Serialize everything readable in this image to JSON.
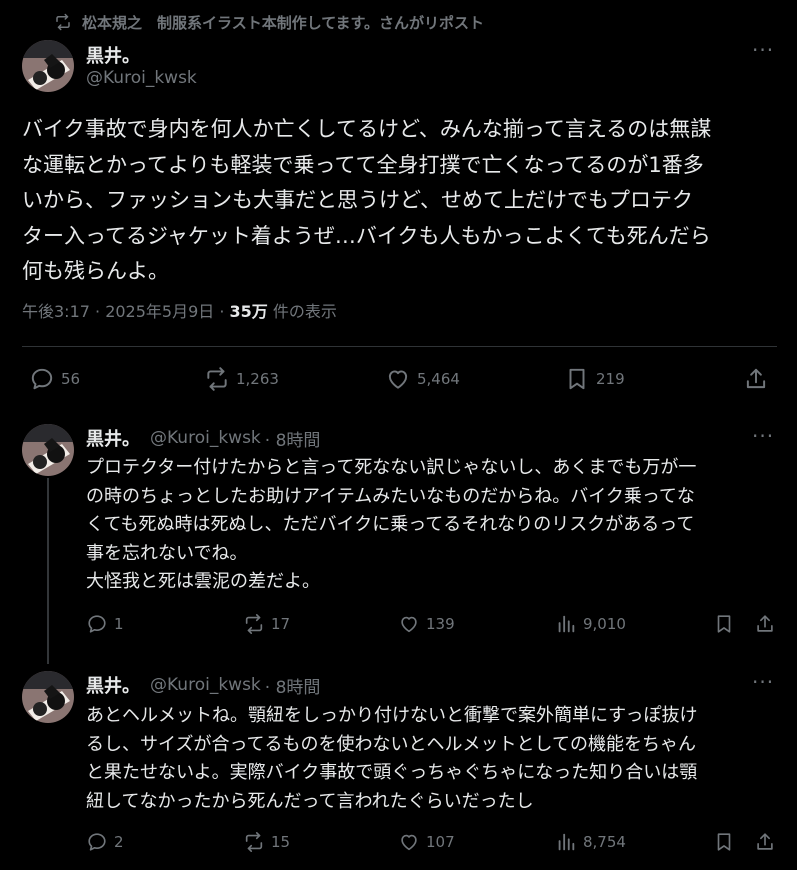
{
  "repost": {
    "text": "松本規之　制服系イラスト本制作してます。さんがリポスト"
  },
  "main": {
    "name": "黒井。",
    "handle": "@Kuroi_kwsk",
    "lines": [
      "バイク事故で身内を何人か亡くしてるけど、みんな揃って言えるのは無謀",
      "な運転とかってよりも軽装で乗ってて全身打撲で亡くなってるのが1番多",
      "いから、ファッションも大事だと思うけど、せめて上だけでもプロテク",
      "ター入ってるジャケット着ようぜ…バイクも人もかっこよくても死んだら",
      "何も残らんよ。"
    ],
    "time": "午後3:17 · 2025年5月9日 · ",
    "views_count": "35万",
    "views_label": " 件の表示",
    "stats": {
      "replies": "56",
      "reposts": "1,263",
      "likes": "5,464",
      "bookmarks": "219"
    }
  },
  "replies": [
    {
      "name": "黒井。",
      "handle": "@Kuroi_kwsk",
      "time": "· 8時間",
      "lines": [
        "プロテクター付けたからと言って死なない訳じゃないし、あくまでも万が一",
        "の時のちょっとしたお助けアイテムみたいなものだからね。バイク乗ってな",
        "くても死ぬ時は死ぬし、ただバイクに乗ってるそれなりのリスクがあるって",
        "事を忘れないでね。",
        "大怪我と死は雲泥の差だよ。"
      ],
      "stats": {
        "replies": "1",
        "reposts": "17",
        "likes": "139",
        "views": "9,010"
      }
    },
    {
      "name": "黒井。",
      "handle": "@Kuroi_kwsk",
      "time": "· 8時間",
      "lines": [
        "あとヘルメットね。顎紐をしっかり付けないと衝撃で案外簡単にすっぽ抜け",
        "るし、サイズが合ってるものを使わないとヘルメットとしての機能をちゃん",
        "と果たせないよ。実際バイク事故で頭ぐっちゃぐちゃになった知り合いは顎",
        "紐してなかったから死んだって言われたぐらいだったし"
      ],
      "stats": {
        "replies": "2",
        "reposts": "15",
        "likes": "107",
        "views": "8,754"
      }
    }
  ],
  "more_label": "···",
  "colors": {
    "background": "#000000",
    "text": "#e7e9ea",
    "muted": "#71767b",
    "divider": "#2f3336"
  }
}
